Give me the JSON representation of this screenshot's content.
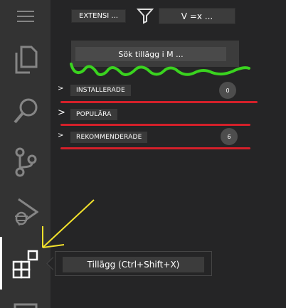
{
  "activity_bar": {
    "items": [
      "menu-icon",
      "explorer-icon",
      "search-icon",
      "source-control-icon",
      "run-debug-icon",
      "extensions-icon",
      "panel-icon"
    ],
    "active": "extensions-icon"
  },
  "header": {
    "view_title": "EXTENSI ...",
    "filter_icon": "filter-icon",
    "more_actions": "V =x ..."
  },
  "search": {
    "placeholder": "Sök tillägg i M ..."
  },
  "sections": [
    {
      "label": "INSTALLERADE",
      "count": "0",
      "chevron": ">"
    },
    {
      "label": "POPULÄRA",
      "chevron": ">"
    },
    {
      "label": "REKOMMENDERADE",
      "count": "6",
      "chevron": ">"
    }
  ],
  "tooltip": {
    "text": "Tillägg (Ctrl+Shift+X)"
  },
  "colors": {
    "activity_bar": "#333333",
    "sidebar": "#252526",
    "green_annotation": "#3ad31f",
    "red_annotation": "#d4202a",
    "yellow_annotation": "#f3e22c"
  }
}
